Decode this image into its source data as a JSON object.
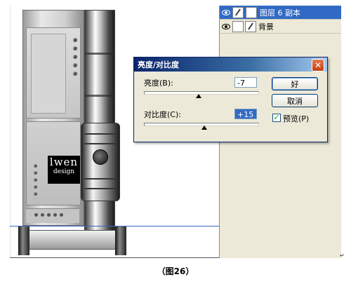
{
  "layers_panel": {
    "layers": [
      {
        "name": "图层 6 副本",
        "selected": true
      },
      {
        "name": "背景",
        "selected": false
      }
    ]
  },
  "artwork": {
    "logo_line1": "lwen",
    "logo_line2": "design"
  },
  "dialog": {
    "title": "亮度/对比度",
    "brightness": {
      "label": "亮度(B):",
      "value": "-7",
      "slider_fraction": 0.48
    },
    "contrast": {
      "label": "对比度(C):",
      "value": "+15",
      "slider_fraction": 0.53
    },
    "ok_label": "好",
    "cancel_label": "取消",
    "preview_label": "预览(P)",
    "preview_checked": true
  },
  "caption": "（图26）",
  "colors": {
    "title_bar": "#0a246a",
    "selection": "#316ac5",
    "close_button": "#c2410f",
    "dialog_bg": "#ece9d8"
  }
}
